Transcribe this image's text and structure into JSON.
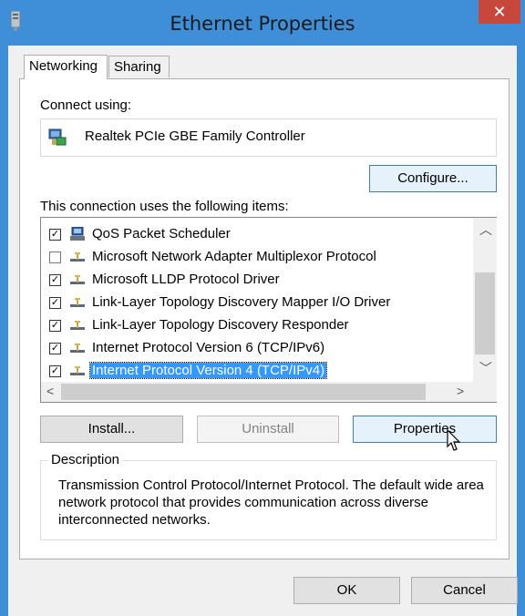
{
  "window": {
    "title": "Ethernet Properties",
    "close_glyph": "✕"
  },
  "tabs": [
    {
      "label": "Networking",
      "active": true
    },
    {
      "label": "Sharing",
      "active": false
    }
  ],
  "connect_using": {
    "label": "Connect using:",
    "adapter": "Realtek PCIe GBE Family Controller",
    "configure_button": "Configure..."
  },
  "items_section": {
    "label": "This connection uses the following items:",
    "items": [
      {
        "label": "QoS Packet Scheduler",
        "checked": true,
        "icon": "network-client-icon",
        "selected": false
      },
      {
        "label": "Microsoft Network Adapter Multiplexor Protocol",
        "checked": false,
        "icon": "protocol-icon",
        "selected": false
      },
      {
        "label": "Microsoft LLDP Protocol Driver",
        "checked": true,
        "icon": "protocol-icon",
        "selected": false
      },
      {
        "label": "Link-Layer Topology Discovery Mapper I/O Driver",
        "checked": true,
        "icon": "protocol-icon",
        "selected": false
      },
      {
        "label": "Link-Layer Topology Discovery Responder",
        "checked": true,
        "icon": "protocol-icon",
        "selected": false
      },
      {
        "label": "Internet Protocol Version 6 (TCP/IPv6)",
        "checked": true,
        "icon": "protocol-icon",
        "selected": false
      },
      {
        "label": "Internet Protocol Version 4 (TCP/IPv4)",
        "checked": true,
        "icon": "protocol-icon",
        "selected": true
      }
    ]
  },
  "buttons": {
    "install": "Install...",
    "uninstall": "Uninstall",
    "properties": "Properties",
    "ok": "OK",
    "cancel": "Cancel"
  },
  "description": {
    "legend": "Description",
    "text": "Transmission Control Protocol/Internet Protocol. The default wide area network protocol that provides communication across diverse interconnected networks."
  },
  "colors": {
    "titlebar": "#3f8fd8",
    "close": "#c7473d",
    "selection": "#3399ff"
  }
}
